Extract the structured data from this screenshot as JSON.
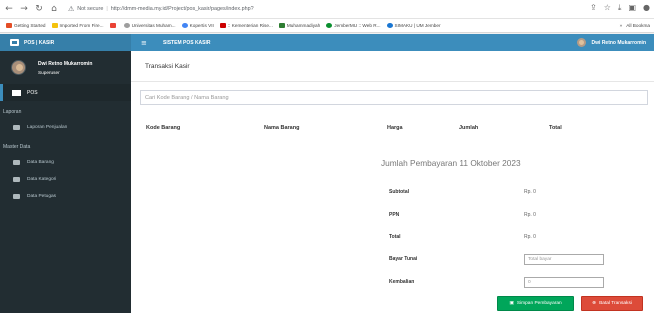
{
  "browser": {
    "secure_label": "Not secure",
    "url": "http://dmm-media.my.id/Project/pos_kasir/pages/index.php?",
    "bookmarks": [
      {
        "label": "Getting Started",
        "color": "#e44d26"
      },
      {
        "label": "Imported From Fire...",
        "color": "#f4c20d"
      },
      {
        "label": "",
        "color": "#ea4335"
      },
      {
        "label": "Universitas Muham...",
        "color": "#9e9e9e"
      },
      {
        "label": "Kopertis VII",
        "color": "#4285f4"
      },
      {
        "label": ":: Kementerian Rise...",
        "color": "#c00"
      },
      {
        "label": "Muhammadiyah",
        "color": "#2e7d32"
      },
      {
        "label": "JemberMU :: Web R...",
        "color": "#0a8f2f"
      },
      {
        "label": "SIMAKU | UM Jember",
        "color": "#1976d2"
      }
    ],
    "more_label": "»",
    "all_bookmarks": "All Bookma"
  },
  "sidebar": {
    "brand": "POS | KASIR",
    "user_name": "Dwi Retno Mukarromin",
    "user_role": "Superuser",
    "active_item": "POS",
    "section_report": "Laporan",
    "report_item": "Laporan Penjualan",
    "section_master": "Master Data",
    "master_items": [
      "Data Barang",
      "Data Kategori",
      "Data Petugas"
    ]
  },
  "topbar": {
    "toggle": "≡",
    "title": "SISTEM POS KASIR",
    "user_name": "Dwi Retno Mukarromin"
  },
  "main": {
    "page_title": "Transaksi Kasir",
    "search_placeholder": "Cari Kode Barang / Nama Barang",
    "columns": [
      "Kode Barang",
      "Nama Barang",
      "Harga",
      "Jumlah",
      "Total"
    ],
    "payment_title": "Jumlah Pembayaran 11 Oktober 2023",
    "subtotal_label": "Subtotal",
    "subtotal_value": "Rp. 0",
    "ppn_label": "PPN",
    "ppn_value": "Rp. 0",
    "total_label": "Total",
    "total_value": "Rp. 0",
    "cash_label": "Bayar Tunai",
    "cash_placeholder": "Total bayar",
    "change_label": "Kembalian",
    "change_value": "0",
    "save_button": "Simpan Pembayaran",
    "cancel_button": "Batal Transaksi"
  },
  "colors": {
    "sidebar": "#222d32",
    "header": "#3c8dbc",
    "save": "#00a65a",
    "cancel": "#dd4b39"
  }
}
